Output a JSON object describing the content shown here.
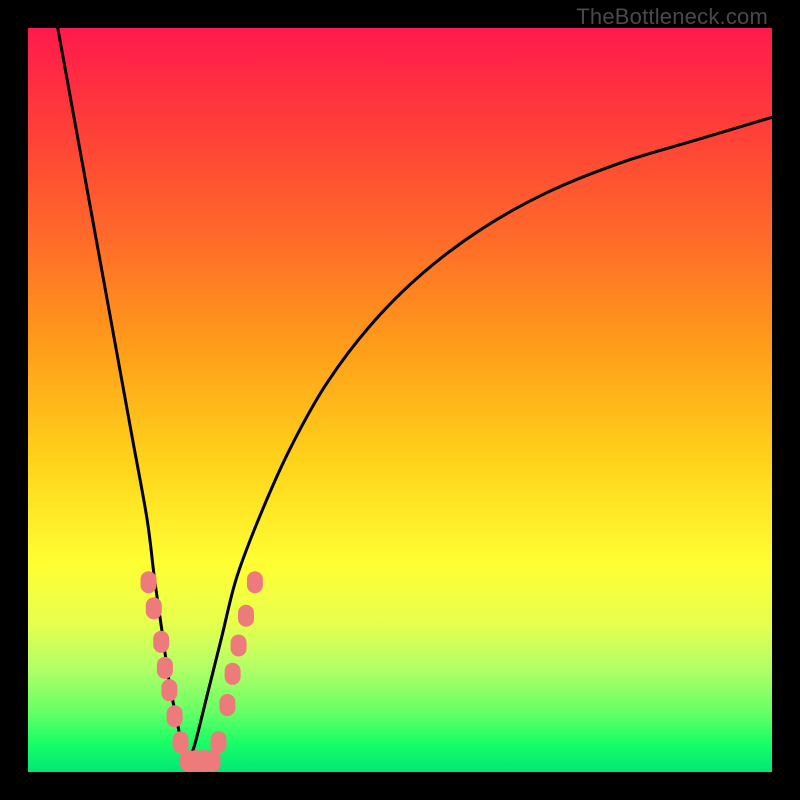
{
  "watermark": "TheBottleneck.com",
  "colors": {
    "frame": "#000000",
    "curve": "#000000",
    "dots": "#ee7b7b",
    "gradient_stops": [
      "#ff1a4d",
      "#ff3a3a",
      "#ff6a2a",
      "#ff9a1a",
      "#ffd21a",
      "#ffff33",
      "#e6ff4d",
      "#b3ff66",
      "#66ff66",
      "#1aff66",
      "#00e676"
    ]
  },
  "chart_data": {
    "type": "line",
    "title": "",
    "xlabel": "",
    "ylabel": "",
    "xlim": [
      0,
      100
    ],
    "ylim": [
      0,
      100
    ],
    "grid": false,
    "legend": false,
    "series": [
      {
        "name": "bottleneck-curve-left",
        "x": [
          4,
          6,
          8,
          10,
          12,
          14,
          16,
          17,
          18,
          19,
          20,
          20.8,
          21.5
        ],
        "y": [
          100,
          89,
          78,
          67,
          56,
          45,
          34,
          26,
          19,
          12,
          7,
          3,
          1
        ]
      },
      {
        "name": "bottleneck-curve-right",
        "x": [
          21.5,
          22.5,
          24,
          26,
          28,
          31,
          35,
          40,
          46,
          53,
          61,
          70,
          80,
          90,
          100
        ],
        "y": [
          1,
          4,
          10,
          18,
          26,
          34,
          43,
          52,
          60,
          67,
          73,
          78,
          82,
          85,
          88
        ]
      }
    ],
    "annotations_dots": [
      {
        "x": 16.2,
        "y": 25.5
      },
      {
        "x": 16.9,
        "y": 22.0
      },
      {
        "x": 17.9,
        "y": 17.5
      },
      {
        "x": 18.4,
        "y": 14.0
      },
      {
        "x": 19.0,
        "y": 11.0
      },
      {
        "x": 19.7,
        "y": 7.5
      },
      {
        "x": 20.5,
        "y": 4.0
      },
      {
        "x": 21.5,
        "y": 1.5
      },
      {
        "x": 22.6,
        "y": 1.5
      },
      {
        "x": 23.7,
        "y": 1.5
      },
      {
        "x": 24.8,
        "y": 1.5
      },
      {
        "x": 25.6,
        "y": 4.0
      },
      {
        "x": 26.8,
        "y": 9.0
      },
      {
        "x": 27.5,
        "y": 13.2
      },
      {
        "x": 28.3,
        "y": 17.0
      },
      {
        "x": 29.3,
        "y": 21.0
      },
      {
        "x": 30.5,
        "y": 25.5
      }
    ]
  }
}
